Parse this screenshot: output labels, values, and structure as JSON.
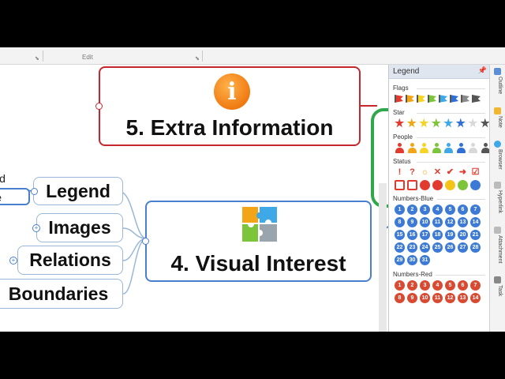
{
  "ribbon": {
    "group_label": "Edit"
  },
  "map": {
    "topic5": {
      "title": "5. Extra Information",
      "icon": "info-icon"
    },
    "topic4": {
      "title": "4. Visual Interest",
      "icon": "puzzle-icon"
    },
    "subtopics": [
      {
        "label": "Legend"
      },
      {
        "label": "Images"
      },
      {
        "label": "Relations"
      },
      {
        "label": "Boundaries"
      }
    ],
    "partial_left_top": "ld",
    "partial_left_bottom": "ve"
  },
  "panel": {
    "title": "Legend",
    "sections": {
      "flags": {
        "label": "Flags",
        "colors": [
          "#e03b2e",
          "#f2a516",
          "#f5d425",
          "#7cc43a",
          "#3fa9e8",
          "#2f6fd6",
          "#8a8a8a",
          "#555555"
        ]
      },
      "star": {
        "label": "Star",
        "colors": [
          "#e03b2e",
          "#f2a516",
          "#f5d425",
          "#7cc43a",
          "#3fa9e8",
          "#2f6fd6",
          "#d8d8d8",
          "#555555"
        ]
      },
      "people": {
        "label": "People",
        "colors": [
          "#e03b2e",
          "#f2a516",
          "#f5d425",
          "#7cc43a",
          "#3fa9e8",
          "#2f6fd6",
          "#d8d8d8",
          "#555555"
        ]
      },
      "status": {
        "label": "Status",
        "row1": [
          "!",
          "?",
          "☼",
          "✕",
          "✔",
          "➜",
          "☑"
        ],
        "row2_colors": [
          "#e03b2e",
          "#e03b2e",
          "#e03b2e",
          "#e03b2e",
          "#f5c418",
          "#7cc43a",
          "#3c7ad6"
        ]
      },
      "numbers_blue": {
        "label": "Numbers-Blue",
        "values": [
          "1",
          "2",
          "3",
          "4",
          "5",
          "6",
          "7",
          "8",
          "9",
          "10",
          "11",
          "12",
          "13",
          "14",
          "15",
          "16",
          "17",
          "18",
          "19",
          "20",
          "21",
          "22",
          "23",
          "24",
          "25",
          "26",
          "27",
          "28",
          "29",
          "30",
          "31"
        ]
      },
      "numbers_red": {
        "label": "Numbers-Red",
        "values": [
          "1",
          "2",
          "3",
          "4",
          "5",
          "6",
          "7",
          "8",
          "9",
          "10",
          "11",
          "12",
          "13",
          "14"
        ]
      }
    }
  },
  "side_tabs": [
    "Outline",
    "Note",
    "Browser",
    "Hyperlink",
    "Attachment",
    "Task"
  ]
}
